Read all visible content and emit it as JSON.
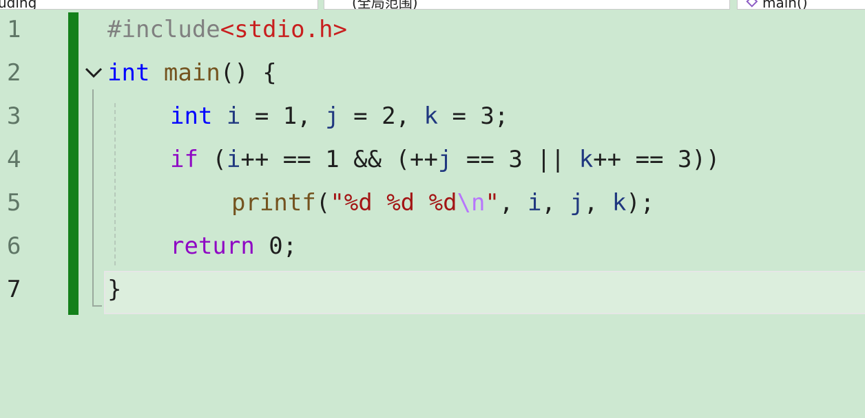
{
  "toolbar": {
    "project": "uding",
    "scope": "(全局范围)",
    "member": "main()"
  },
  "line_numbers": [
    "1",
    "2",
    "3",
    "4",
    "5",
    "6",
    "7"
  ],
  "code": {
    "line1": {
      "directive": "#include",
      "header": "<stdio.h>"
    },
    "line2": {
      "type": "int",
      "sp": " ",
      "func": "main",
      "rest": "() {"
    },
    "line3": {
      "type": "int",
      "sp": " ",
      "v1": "i",
      "a1": " = 1, ",
      "v2": "j",
      "a2": " = 2, ",
      "v3": "k",
      "a3": " = 3;"
    },
    "line4": {
      "kw": "if",
      "p1": " (",
      "v1": "i",
      "p2": "++ == 1 && (++",
      "v2": "j",
      "p3": " == 3 || ",
      "v3": "k",
      "p4": "++ == 3))"
    },
    "line5": {
      "func": "printf",
      "p1": "(",
      "str1": "\"%d %d %d",
      "esc": "\\n",
      "str2": "\"",
      "c1": ", ",
      "v1": "i",
      "c2": ", ",
      "v2": "j",
      "c3": ", ",
      "v3": "k",
      "end": ");"
    },
    "line6": {
      "kw": "return",
      "rest": " 0;"
    },
    "line7": {
      "brace": "}"
    }
  },
  "colors": {
    "background": "#cde8d1",
    "change_bar": "#14801b",
    "keyword": "#0000ff",
    "control": "#8f08c4",
    "function": "#74531f",
    "variable": "#1f377f",
    "string": "#a31515"
  }
}
